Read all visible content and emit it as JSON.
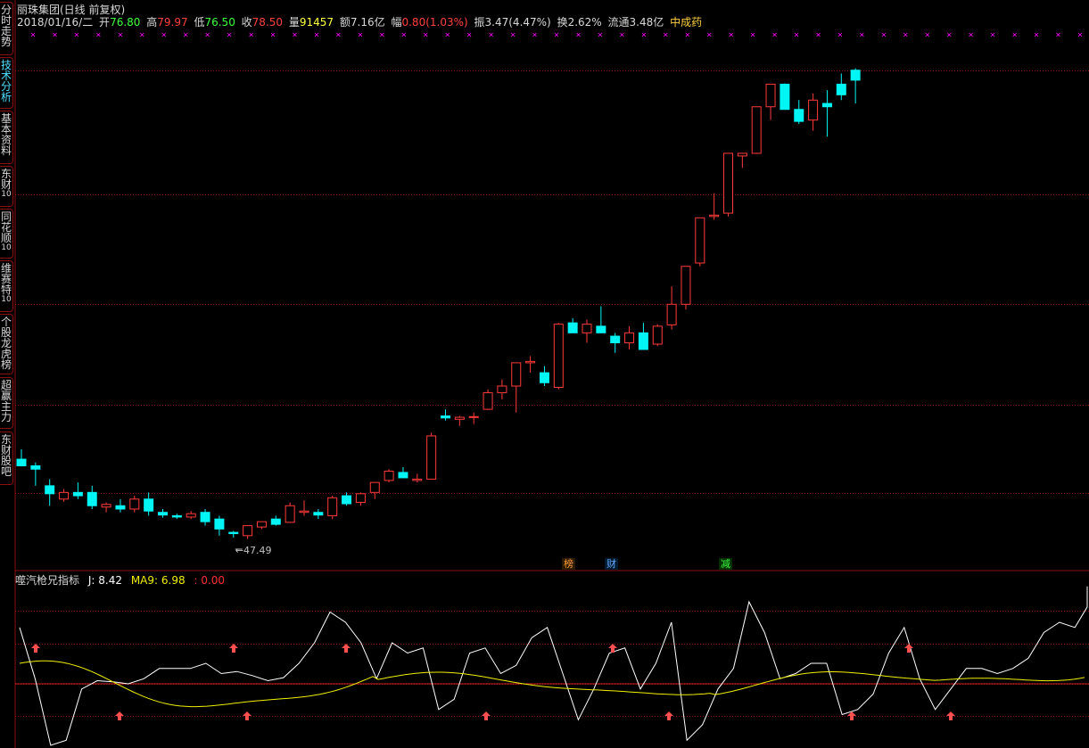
{
  "sidebar": {
    "tabs": [
      {
        "label": "分时走势",
        "sub": ""
      },
      {
        "label": "技术分析",
        "sub": "",
        "active": true
      },
      {
        "label": "基本资料",
        "sub": ""
      },
      {
        "label": "东财",
        "sub": "10"
      },
      {
        "label": "同花顺",
        "sub": "10"
      },
      {
        "label": "维赛特",
        "sub": "10"
      },
      {
        "label": "个股龙虎榜",
        "sub": ""
      },
      {
        "label": "超赢主力",
        "sub": ""
      },
      {
        "label": "东财股吧",
        "sub": ""
      }
    ]
  },
  "header": {
    "title": "丽珠集团(日线 前复权)",
    "date": "2018/01/16/二",
    "open_label": "开",
    "open": "76.80",
    "high_label": "高",
    "high": "79.97",
    "low_label": "低",
    "low": "76.50",
    "close_label": "收",
    "close": "78.50",
    "vol_label": "量",
    "vol": "91457",
    "amt_label": "额",
    "amt": "7.16亿",
    "chg_label": "幅",
    "chg": "0.80(1.03%)",
    "amp_label": "振",
    "amp": "3.47(4.47%)",
    "turn_label": "换",
    "turn": "2.62%",
    "float_label": "流通",
    "float": "3.48亿",
    "sector": "中成药"
  },
  "colors": {
    "up": "#ff3a3a",
    "down": "#00f5f5",
    "grid": "#8a1010",
    "ma": "#f0f000",
    "j": "#ffffff",
    "marker": "#ff00ff"
  },
  "candles": [
    [
      79,
      80.5,
      78.2,
      78
    ],
    [
      78,
      78.5,
      75,
      77.5
    ],
    [
      75,
      76,
      72,
      73.8
    ],
    [
      73,
      74.5,
      72.6,
      74
    ],
    [
      74,
      75.5,
      73,
      73.5
    ],
    [
      74,
      75,
      71.5,
      72
    ],
    [
      71.8,
      72.5,
      71,
      72.2
    ],
    [
      72,
      73,
      71,
      71.5
    ],
    [
      71.5,
      73.5,
      71,
      73
    ],
    [
      73,
      74,
      70.5,
      71.2
    ],
    [
      71,
      71.5,
      70.2,
      70.6
    ],
    [
      70.5,
      70.8,
      70,
      70.3
    ],
    [
      70.3,
      71.2,
      70,
      70.8
    ],
    [
      71,
      71.5,
      69,
      69.6
    ],
    [
      70,
      70.5,
      67.5,
      68.5
    ],
    [
      68,
      68.2,
      47.49,
      67.8
    ],
    [
      67.5,
      69,
      67,
      69
    ],
    [
      68.8,
      69.5,
      68.5,
      69.6
    ],
    [
      70,
      70.5,
      69,
      69.2
    ],
    [
      69.5,
      72.5,
      69.4,
      72
    ],
    [
      71,
      72.8,
      70.5,
      71.2
    ],
    [
      71,
      71.5,
      70,
      70.6
    ],
    [
      70.5,
      73.5,
      70,
      73.2
    ],
    [
      73.5,
      74,
      72,
      72.3
    ],
    [
      72.5,
      74,
      72,
      73.8
    ],
    [
      74,
      75.5,
      73,
      75.5
    ],
    [
      75.8,
      77.5,
      75.5,
      77.2
    ],
    [
      77,
      77.8,
      76.5,
      76.2
    ],
    [
      75.8,
      76.8,
      75.5,
      76
    ],
    [
      76,
      83,
      76.4,
      82.5
    ],
    [
      85.5,
      86.5,
      84.8,
      85.2
    ],
    [
      85,
      85.5,
      84,
      85.3
    ],
    [
      85.3,
      86,
      84.3,
      85.4
    ],
    [
      86.5,
      89.5,
      86.4,
      89
    ],
    [
      89,
      91,
      88,
      90
    ],
    [
      90,
      93,
      86,
      93.5
    ],
    [
      93.5,
      94.5,
      92,
      93.7
    ],
    [
      92,
      93,
      90,
      90.5
    ],
    [
      89.8,
      99.5,
      89.5,
      99.3
    ],
    [
      99.5,
      100.2,
      98.2,
      98
    ],
    [
      98,
      100,
      96.5,
      99.3
    ],
    [
      99,
      102,
      98.5,
      98
    ],
    [
      97.5,
      98,
      95,
      96.5
    ],
    [
      96.5,
      99,
      95.5,
      98
    ],
    [
      98,
      99.5,
      95.5,
      95.5
    ],
    [
      96.3,
      99.3,
      96,
      99
    ],
    [
      99.2,
      105,
      98.5,
      102.3
    ],
    [
      102.3,
      108,
      101.5,
      108
    ],
    [
      108.5,
      115,
      108,
      115.3
    ],
    [
      115.5,
      119,
      115,
      115.7
    ],
    [
      116,
      124,
      115.5,
      125
    ],
    [
      124.6,
      123,
      122.8,
      125
    ],
    [
      125,
      130,
      124.9,
      132
    ],
    [
      132,
      135,
      130,
      135.4
    ],
    [
      135.4,
      135.5,
      131.9,
      131.6
    ],
    [
      131.6,
      133,
      129.4,
      129.8
    ],
    [
      130,
      134,
      128.4,
      133
    ],
    [
      132.5,
      134.5,
      127.5,
      132
    ],
    [
      135.4,
      137,
      133,
      133.8
    ],
    [
      137.5,
      137.8,
      132.5,
      136
    ]
  ],
  "markers_top": "× × × × × × ×   × ×  × × × × ×  ×    × × × ×  × × × × × × × ×    × × × × × × × × × × × × × × × ×   × × ×  ×   × ×",
  "low_label": "47.49",
  "tags": [
    {
      "text": "榜",
      "color": "#ff9b3a",
      "bg": "#2a1a00"
    },
    {
      "text": "财",
      "color": "#66aaff",
      "bg": "#001a30"
    },
    {
      "text": "减",
      "color": "#40ff40",
      "bg": "#003000"
    }
  ],
  "indicator": {
    "name": "噬汽枪兄指标",
    "j_label": "J:",
    "j": "8.42",
    "ma_label": "MA9:",
    "ma": "6.98",
    "extra_label": ":",
    "extra": "0.00"
  }
}
